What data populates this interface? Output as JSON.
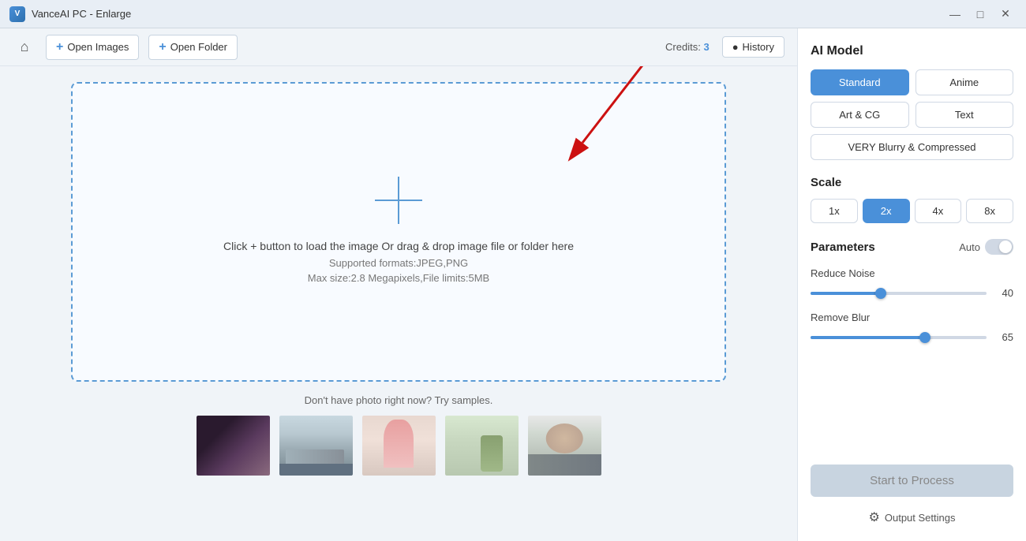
{
  "titleBar": {
    "title": "VanceAI PC - Enlarge",
    "appIconText": "V"
  },
  "toolbar": {
    "openImagesLabel": "Open Images",
    "openFolderLabel": "Open Folder",
    "creditsLabel": "Credits:",
    "creditsCount": "3",
    "historyLabel": "History"
  },
  "dropZone": {
    "mainText": "Click + button to load the image Or drag & drop image file or folder here",
    "subText1": "Supported formats:JPEG,PNG",
    "subText2": "Max size:2.8 Megapixels,File limits:5MB"
  },
  "samples": {
    "label": "Don't have photo right now? Try samples."
  },
  "rightPanel": {
    "aiModelTitle": "AI Model",
    "models": [
      {
        "id": "standard",
        "label": "Standard",
        "active": true,
        "wide": false
      },
      {
        "id": "anime",
        "label": "Anime",
        "active": false,
        "wide": false
      },
      {
        "id": "artcg",
        "label": "Art & CG",
        "active": false,
        "wide": false
      },
      {
        "id": "text",
        "label": "Text",
        "active": false,
        "wide": false
      },
      {
        "id": "veryblurry",
        "label": "VERY Blurry & Compressed",
        "active": false,
        "wide": true
      }
    ],
    "scaleTitle": "Scale",
    "scales": [
      {
        "label": "1x",
        "active": false
      },
      {
        "label": "2x",
        "active": true
      },
      {
        "label": "4x",
        "active": false
      },
      {
        "label": "8x",
        "active": false
      }
    ],
    "paramsTitle": "Parameters",
    "autoLabel": "Auto",
    "reduceNoiseLabel": "Reduce Noise",
    "reduceNoiseValue": "40",
    "reduceNoisePercent": 40,
    "removeBlurLabel": "Remove Blur",
    "removeBlurValue": "65",
    "removeBlurPercent": 65,
    "startBtnLabel": "Start to Process",
    "outputSettingsLabel": "Output Settings"
  }
}
